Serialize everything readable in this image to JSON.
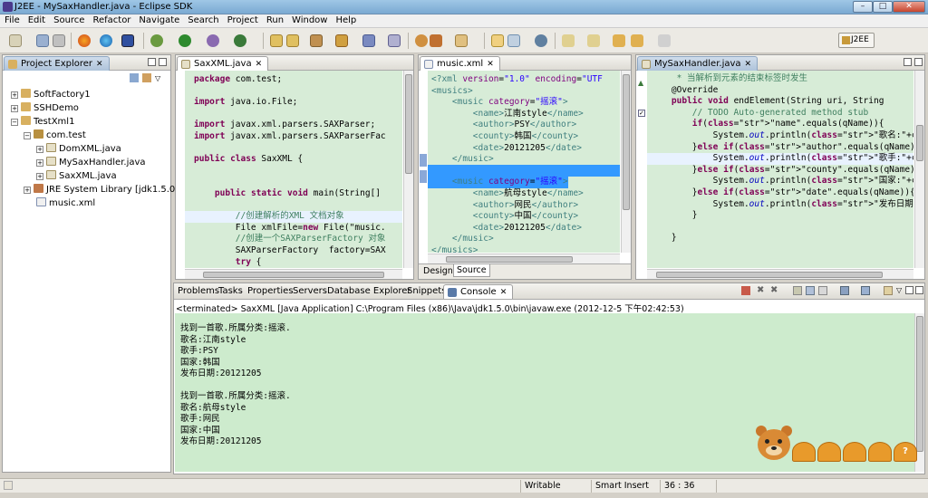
{
  "window": {
    "title": "J2EE - MySaxHandler.java - Eclipse SDK",
    "min": "–",
    "max": "□",
    "close": "✕"
  },
  "menu": [
    "File",
    "Edit",
    "Source",
    "Refactor",
    "Navigate",
    "Search",
    "Project",
    "Run",
    "Window",
    "Help"
  ],
  "toolbar": {
    "perspective": "J2EE"
  },
  "explorer": {
    "tab": "Project Explorer",
    "items": [
      {
        "label": "SoftFactory1",
        "depth": 0,
        "expanded": false,
        "icon": "project-icon"
      },
      {
        "label": "SSHDemo",
        "depth": 0,
        "expanded": false,
        "icon": "project-icon"
      },
      {
        "label": "TestXml1",
        "depth": 0,
        "expanded": true,
        "icon": "project-icon"
      },
      {
        "label": "com.test",
        "depth": 1,
        "expanded": true,
        "icon": "package-icon"
      },
      {
        "label": "DomXML.java",
        "depth": 2,
        "expanded": false,
        "icon": "java-file-icon"
      },
      {
        "label": "MySaxHandler.java",
        "depth": 2,
        "expanded": false,
        "icon": "java-file-icon"
      },
      {
        "label": "SaxXML.java",
        "depth": 2,
        "expanded": false,
        "icon": "java-file-icon"
      },
      {
        "label": "JRE System Library [jdk1.5.0]",
        "depth": 1,
        "expanded": false,
        "icon": "library-icon"
      },
      {
        "label": "music.xml",
        "depth": 1,
        "expanded": false,
        "icon": "xml-file-icon"
      }
    ]
  },
  "editor1": {
    "tab": "SaxXML.java",
    "lines": [
      "package com.test;",
      "",
      "import java.io.File;",
      "",
      "import javax.xml.parsers.SAXParser;",
      "import javax.xml.parsers.SAXParserFac",
      "",
      "public class SaxXML {",
      "",
      "",
      "    public static void main(String[]",
      "",
      "        //创建解析的XML 文档对象",
      "        File xmlFile=new File(\"music.",
      "        //创建一个SAXParserFactory 对象",
      "        SAXParserFactory  factory=SAX",
      "        try {"
    ]
  },
  "editor2": {
    "tab": "music.xml",
    "lines": [
      "<?xml version=\"1.0\" encoding=\"UTF",
      "<musics>",
      "    <music category=\"摇滚\">",
      "        <name>江南style</name>",
      "        <author>PSY</author>",
      "        <county>韩国</county>",
      "        <date>20121205</date>",
      "    </music>",
      "",
      "    <music category=\"摇滚\">",
      "        <name>航母style</name>",
      "        <author>网民</author>",
      "        <county>中国</county>",
      "        <date>20121205</date>",
      "    </music>",
      "</musics>"
    ],
    "tabs": [
      "Design",
      "Source"
    ]
  },
  "editor3": {
    "tab": "MySaxHandler.java",
    "lines": [
      "     * 当解析到元素的结束标签时发生",
      "    @Override",
      "    public void endElement(String uri, String",
      "        // TODO Auto-generated method stub",
      "        if(\"name\".equals(qName)){",
      "            System.out.println(\"歌名:\"+conte",
      "        }else if(\"author\".equals(qName)){",
      "            System.out.println(\"歌手:\"+conte",
      "        }else if(\"county\".equals(qName)){",
      "            System.out.println(\"国家:\"+conte",
      "        }else if(\"date\".equals(qName)){",
      "            System.out.println(\"发布日期:\"+c",
      "        }",
      "",
      "    }"
    ]
  },
  "bottom": {
    "tabs": [
      "Problems",
      "Tasks",
      "Properties",
      "Servers",
      "Database Explorer",
      "Snippets",
      "Console"
    ],
    "terminated": "<terminated> SaxXML [Java Application] C:\\Program Files (x86)\\Java\\jdk1.5.0\\bin\\javaw.exe (2012-12-5 下午02:42:53)",
    "output": [
      "找到一首歌.所属分类:摇滚.",
      "歌名:江南style",
      "歌手:PSY",
      "国家:韩国",
      "发布日期:20121205",
      "",
      "找到一首歌.所属分类:摇滚.",
      "歌名:航母style",
      "歌手:网民",
      "国家:中国",
      "发布日期:20121205"
    ]
  },
  "status": {
    "writable": "Writable",
    "insert": "Smart Insert",
    "position": "36 : 36"
  },
  "mascot": {
    "buttons": [
      "",
      "",
      "",
      "",
      "?"
    ]
  },
  "colors": {
    "accent": "#6d8fb0",
    "console_bg": "#cdebcd",
    "editor_bg": "#d7ecd7",
    "selection": "#3399ff"
  }
}
